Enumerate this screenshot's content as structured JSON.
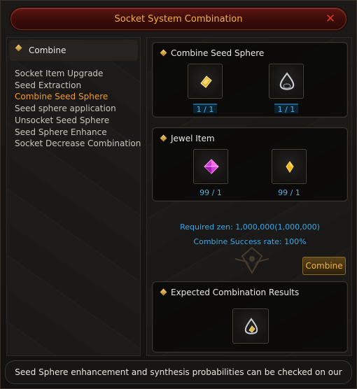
{
  "window": {
    "title": "Socket System Combination",
    "close_icon": "close-x-icon"
  },
  "sidebar": {
    "header": "Combine",
    "items": [
      {
        "label": "Socket Item Upgrade",
        "active": false
      },
      {
        "label": "Seed Extraction",
        "active": false
      },
      {
        "label": "Combine Seed Sphere",
        "active": true
      },
      {
        "label": "Seed sphere application",
        "active": false
      },
      {
        "label": "Unsocket Seed Sphere",
        "active": false
      },
      {
        "label": "Seed Sphere Enhance",
        "active": false
      },
      {
        "label": "Socket Decrease Combination",
        "active": false
      }
    ]
  },
  "seed_sphere": {
    "title": "Combine Seed Sphere",
    "slots": [
      {
        "icon": "seed-gem-icon",
        "count": "1 / 1"
      },
      {
        "icon": "sphere-ring-icon",
        "count": "1 / 1"
      }
    ]
  },
  "jewel": {
    "title": "Jewel Item",
    "slots": [
      {
        "icon": "jewel-pink-icon",
        "count": "99 / 1"
      },
      {
        "icon": "jewel-gold-icon",
        "count": "99 / 1"
      }
    ]
  },
  "requirements": {
    "zen": "Required zen: 1,000,000(1,000,000)",
    "success_rate": "Combine Success rate: 100%"
  },
  "combine_button": "Combine",
  "results": {
    "title": "Expected Combination Results",
    "slot_icon": "seed-sphere-result-icon"
  },
  "notice": "Seed Sphere enhancement and synthesis probabilities can be checked on our",
  "colors": {
    "accent_orange": "#f09a2a",
    "title_gold": "#f2b13c",
    "info_blue": "#39a8e6",
    "title_bar_red": "#5a1511"
  }
}
